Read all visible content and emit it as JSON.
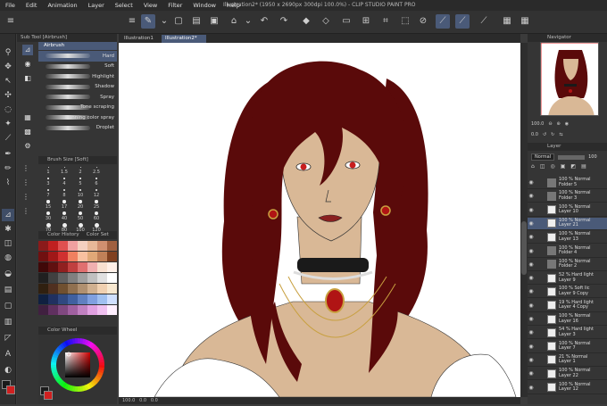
{
  "menu": [
    "File",
    "Edit",
    "Animation",
    "Layer",
    "Select",
    "View",
    "Filter",
    "Window",
    "Help"
  ],
  "window_title": "Illustration2* (1950 x 2690px 300dpi 100.0%) - CLIP STUDIO PAINT PRO",
  "subtool_panel": {
    "tabs": [
      "Sub Tool [Airbrush]"
    ],
    "header": "Airbrush",
    "items": [
      "Soft",
      "Hard",
      "Soft",
      "Highlight",
      "Shadow",
      "Spray",
      "Tone scraping",
      "Running color spray",
      "Droplet"
    ],
    "selected_index": 1
  },
  "brush_size": {
    "tab": "Brush Size [Soft]",
    "sizes": [
      "1",
      "1.5",
      "2",
      "2.5",
      "3",
      "4",
      "5",
      "6",
      "7",
      "8",
      "10",
      "12",
      "15",
      "17",
      "20",
      "25",
      "30",
      "40",
      "50",
      "60",
      "70",
      "80",
      "100",
      "120"
    ]
  },
  "color_history": {
    "tabs": [
      "Color History",
      "Color Set"
    ]
  },
  "color_wheel": {
    "tab": "Color Wheel"
  },
  "canvas_tabs": [
    "Illustration1",
    "Illustration2*"
  ],
  "status": {
    "zoom": "100.0",
    "coords": "0.0",
    "pos": "0.0"
  },
  "navigator": {
    "tab": "Navigator",
    "zoom": "100.0",
    "angle": "0.0"
  },
  "layer_panel": {
    "tab": "Layer",
    "blend": "Normal",
    "opacity": "100",
    "layers": [
      {
        "name": "100 % Normal\nFolder 5",
        "type": "folder"
      },
      {
        "name": "100 % Normal\nFolder 3",
        "type": "folder"
      },
      {
        "name": "100 % Normal\nLayer 10",
        "type": "layer"
      },
      {
        "name": "100 % Normal\nLayer 21",
        "type": "layer",
        "active": true
      },
      {
        "name": "100 % Normal\nLayer 13",
        "type": "layer"
      },
      {
        "name": "100 % Normal\nFolder 4",
        "type": "folder"
      },
      {
        "name": "100 % Normal\nFolder 2",
        "type": "folder"
      },
      {
        "name": "52 % Hard light\nLayer 9",
        "type": "layer"
      },
      {
        "name": "100 % Soft lic\nLayer 9 Copy",
        "type": "layer"
      },
      {
        "name": "19 % Hard light\nLayer 4 Copy",
        "type": "layer"
      },
      {
        "name": "100 % Normal\nLayer 16",
        "type": "layer"
      },
      {
        "name": "54 % Hard light\nLayer 3",
        "type": "layer"
      },
      {
        "name": "100 % Normal\nLayer 7",
        "type": "layer"
      },
      {
        "name": "21 % Normal\nLayer 1",
        "type": "layer"
      },
      {
        "name": "100 % Normal\nLayer 22",
        "type": "layer"
      },
      {
        "name": "100 % Normal\nLayer 12",
        "type": "layer"
      }
    ]
  },
  "colors": {
    "accent": "#4a5a78",
    "hair": "#5a0a0a",
    "skin": "#d9b896",
    "eye": "#c81e1e",
    "gem": "#b01414",
    "gold": "#c8a040",
    "main_fg": "#1a1a1a",
    "main_bg": "#d12020"
  }
}
